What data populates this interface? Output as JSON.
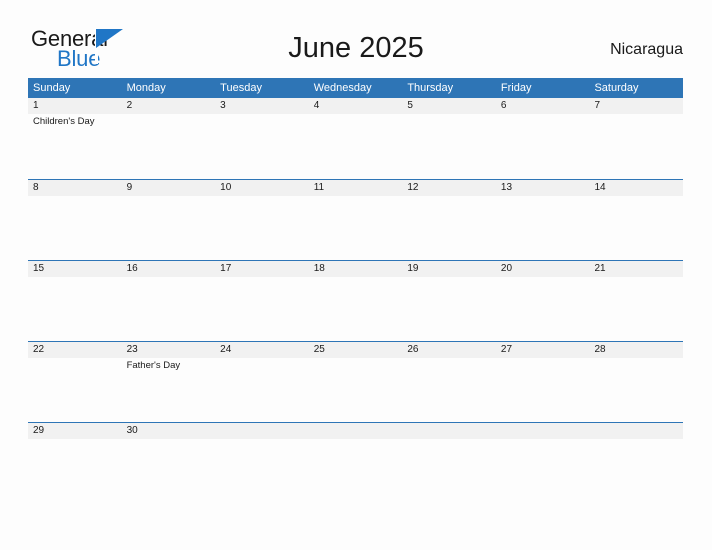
{
  "brand": {
    "name_part1": "General",
    "name_part2": "Blue",
    "triangle_icon": "brand-triangle-icon",
    "color_primary": "#2076c6",
    "color_text": "#1a1a1a"
  },
  "header": {
    "title": "June 2025",
    "region": "Nicaragua"
  },
  "theme": {
    "header_bar_color": "#2e75b6",
    "date_band_color": "#f1f1f1",
    "row_divider_color": "#2e75b6",
    "page_background": "#fdfdfd"
  },
  "calendar": {
    "day_names": [
      "Sunday",
      "Monday",
      "Tuesday",
      "Wednesday",
      "Thursday",
      "Friday",
      "Saturday"
    ],
    "weeks": [
      [
        {
          "date": "1",
          "events": [
            "Children's Day"
          ]
        },
        {
          "date": "2",
          "events": []
        },
        {
          "date": "3",
          "events": []
        },
        {
          "date": "4",
          "events": []
        },
        {
          "date": "5",
          "events": []
        },
        {
          "date": "6",
          "events": []
        },
        {
          "date": "7",
          "events": []
        }
      ],
      [
        {
          "date": "8",
          "events": []
        },
        {
          "date": "9",
          "events": []
        },
        {
          "date": "10",
          "events": []
        },
        {
          "date": "11",
          "events": []
        },
        {
          "date": "12",
          "events": []
        },
        {
          "date": "13",
          "events": []
        },
        {
          "date": "14",
          "events": []
        }
      ],
      [
        {
          "date": "15",
          "events": []
        },
        {
          "date": "16",
          "events": []
        },
        {
          "date": "17",
          "events": []
        },
        {
          "date": "18",
          "events": []
        },
        {
          "date": "19",
          "events": []
        },
        {
          "date": "20",
          "events": []
        },
        {
          "date": "21",
          "events": []
        }
      ],
      [
        {
          "date": "22",
          "events": []
        },
        {
          "date": "23",
          "events": [
            "Father's Day"
          ]
        },
        {
          "date": "24",
          "events": []
        },
        {
          "date": "25",
          "events": []
        },
        {
          "date": "26",
          "events": []
        },
        {
          "date": "27",
          "events": []
        },
        {
          "date": "28",
          "events": []
        }
      ],
      [
        {
          "date": "29",
          "events": []
        },
        {
          "date": "30",
          "events": []
        },
        {
          "date": "",
          "events": []
        },
        {
          "date": "",
          "events": []
        },
        {
          "date": "",
          "events": []
        },
        {
          "date": "",
          "events": []
        },
        {
          "date": "",
          "events": []
        }
      ]
    ]
  }
}
